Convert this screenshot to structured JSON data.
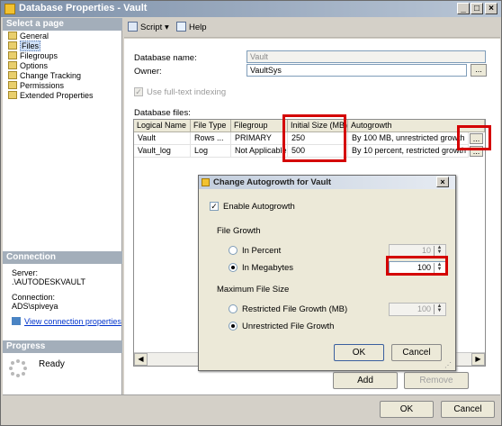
{
  "window": {
    "title": "Database Properties - Vault",
    "controls": {
      "minimize": "_",
      "maximize": "□",
      "close": "×"
    }
  },
  "left_panel": {
    "select_page_header": "Select a page",
    "pages": [
      {
        "label": "General",
        "selected": false
      },
      {
        "label": "Files",
        "selected": true
      },
      {
        "label": "Filegroups",
        "selected": false
      },
      {
        "label": "Options",
        "selected": false
      },
      {
        "label": "Change Tracking",
        "selected": false
      },
      {
        "label": "Permissions",
        "selected": false
      },
      {
        "label": "Extended Properties",
        "selected": false
      }
    ],
    "connection_header": "Connection",
    "server_label": "Server:",
    "server_value": ".\\AUTODESKVAULT",
    "connection_label": "Connection:",
    "connection_value": "ADS\\spiveya",
    "view_connection_link": "View connection properties",
    "progress_header": "Progress",
    "progress_status": "Ready"
  },
  "toolbar": {
    "script_label": "Script",
    "script_arrow": "▾",
    "help_label": "Help"
  },
  "main": {
    "database_name_label": "Database name:",
    "database_name_value": "Vault",
    "owner_label": "Owner:",
    "owner_value": "VaultSys",
    "owner_browse": "...",
    "fulltext_label": "Use full-text indexing",
    "fulltext_checked": true,
    "database_files_label": "Database files:",
    "columns": [
      "Logical Name",
      "File Type",
      "Filegroup",
      "Initial Size (MB)",
      "Autogrowth"
    ],
    "rows": [
      {
        "logical_name": "Vault",
        "file_type": "Rows ...",
        "filegroup": "PRIMARY",
        "initial_size": "250",
        "autogrowth": "By 100 MB, unrestricted growth",
        "browse": "..."
      },
      {
        "logical_name": "Vault_log",
        "file_type": "Log",
        "filegroup": "Not Applicable",
        "initial_size": "500",
        "autogrowth": "By 10 percent, restricted growth t...",
        "browse": "..."
      }
    ],
    "add_button": "Add",
    "remove_button": "Remove",
    "scroll_left": "◀",
    "scroll_right": "▶"
  },
  "dialog": {
    "title": "Change Autogrowth for Vault",
    "close": "×",
    "enable_autogrowth_label": "Enable Autogrowth",
    "enable_autogrowth_checked": true,
    "file_growth_label": "File Growth",
    "in_percent_label": "In Percent",
    "in_percent_value": "10",
    "in_megabytes_label": "In Megabytes",
    "in_megabytes_value": "100",
    "selected_growth": "In Megabytes",
    "max_file_size_label": "Maximum File Size",
    "restricted_label": "Restricted File Growth (MB)",
    "restricted_value": "100",
    "unrestricted_label": "Unrestricted File Growth",
    "selected_max": "Unrestricted File Growth",
    "ok_button": "OK",
    "cancel_button": "Cancel"
  },
  "footer": {
    "ok_button": "OK",
    "cancel_button": "Cancel"
  },
  "colors": {
    "highlight_box": "#d40000",
    "section_header": "#a3aeba",
    "link": "#0033cc"
  }
}
